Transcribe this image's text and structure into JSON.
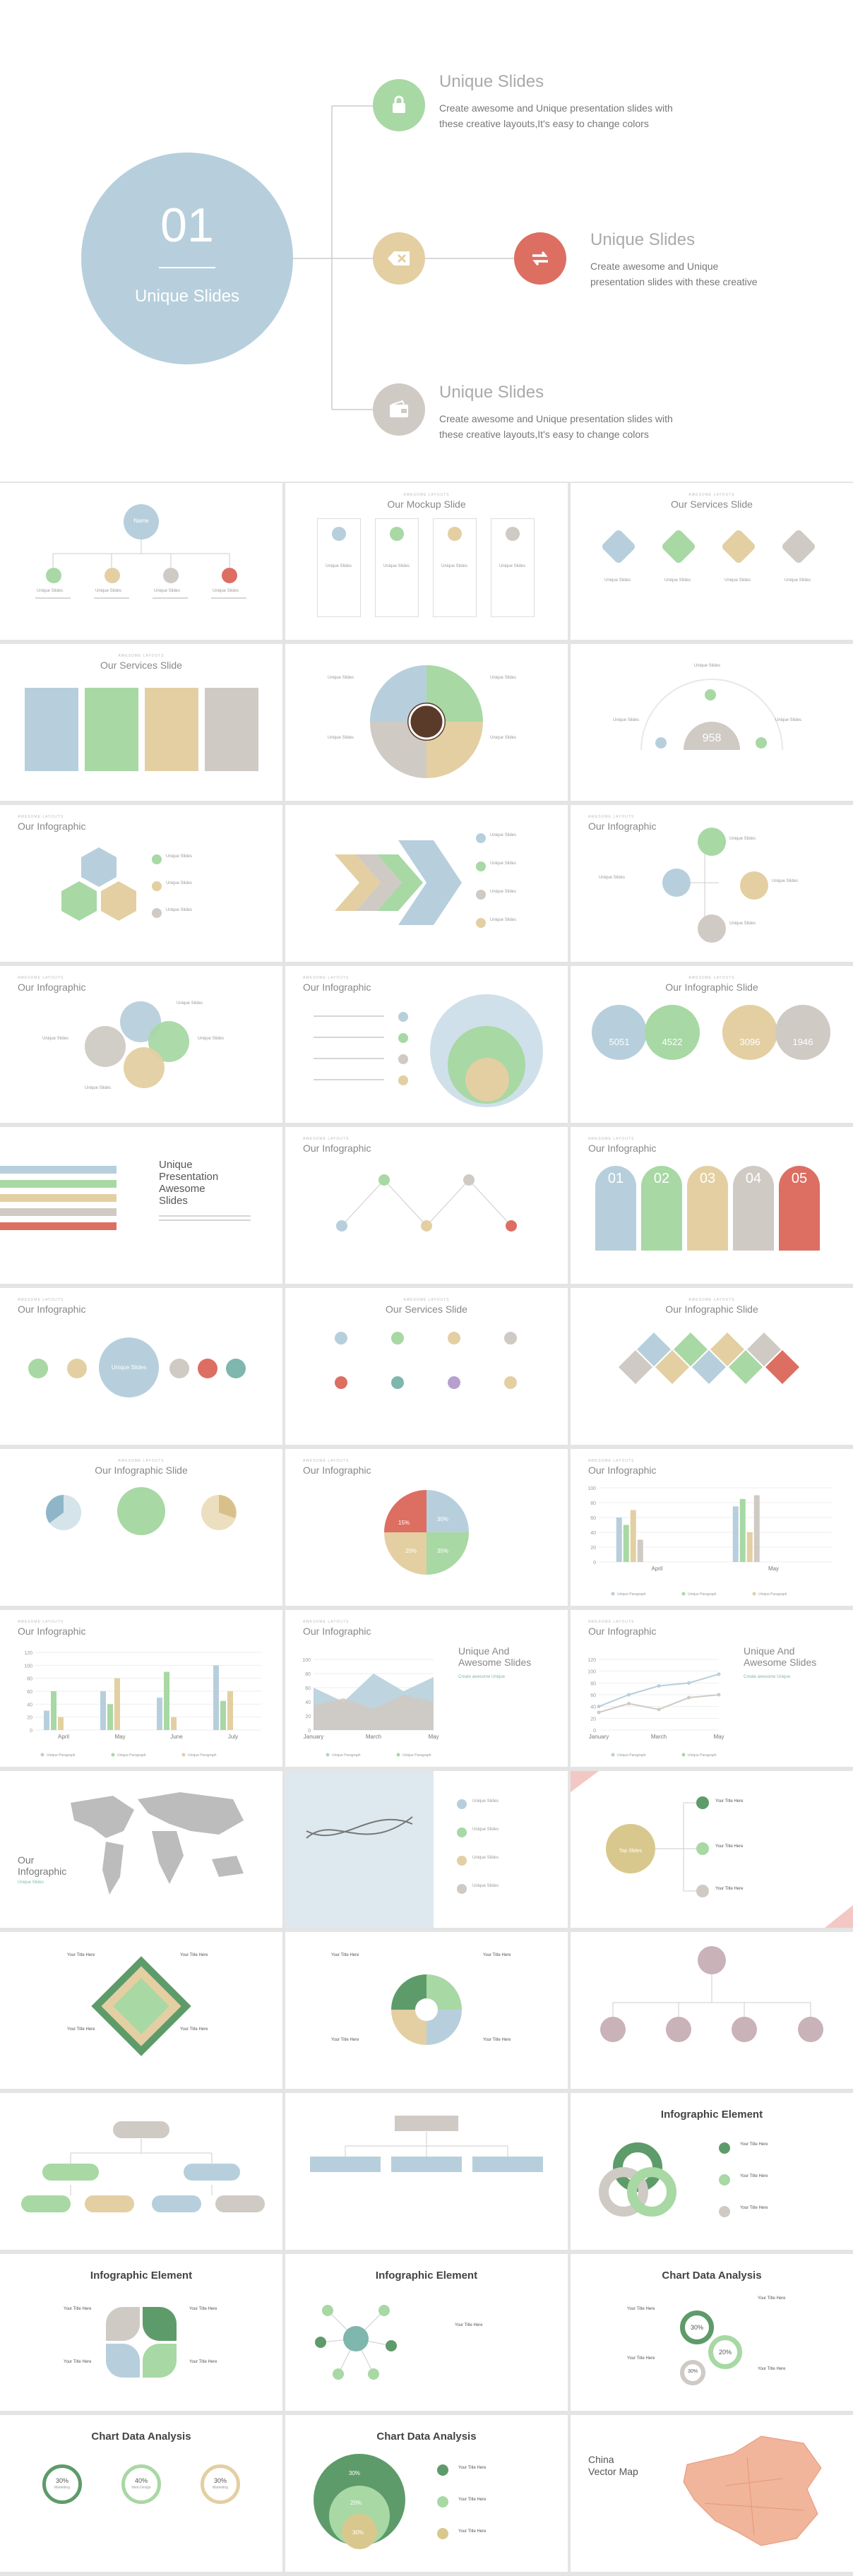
{
  "palette": {
    "blue": "#b7cfdc",
    "green": "#a8d8a4",
    "tan": "#e3cfa2",
    "gray": "#cfcac4",
    "red": "#dd6e62",
    "teal": "#7fb6ad",
    "darkgreen": "#5e9b6a"
  },
  "hero": {
    "number": "01",
    "subtitle": "Unique Slides",
    "items": [
      {
        "title": "Unique Slides",
        "body_line1": "Create awesome and Unique presentation slides with",
        "body_line2": "these creative layouts,It's easy to change colors",
        "icon": "lock-icon"
      },
      {
        "title": "Unique Slides",
        "body_line1": "Create awesome and Unique",
        "body_line2": "presentation slides with these creative",
        "icon": "exchange-icon"
      },
      {
        "title": "Unique Slides",
        "body_line1": "Create awesome and Unique presentation slides with",
        "body_line2": "these creative layouts,It's easy to change colors",
        "icon": "wallet-icon"
      }
    ]
  },
  "common": {
    "kicker": "AWESOME LAYOUTS",
    "unique": "Unique Slides",
    "your_title": "Your Title Here",
    "our_infographic": "Our Infographic",
    "infographic_slide": "Our Infographic Slide",
    "infographic_element": "Infographic Element",
    "chart_data_analysis": "Chart Data Analysis",
    "services": "Our Services Slide",
    "mockup": "Our Mockup Slide"
  },
  "slides": {
    "org_root": "Name",
    "gauge_value": "958",
    "bubbles": [
      "5051",
      "4522",
      "3096",
      "1946"
    ],
    "numbered": [
      "01",
      "02",
      "03",
      "04",
      "05"
    ],
    "awesome": {
      "line1": "Unique",
      "line2": "Presentation",
      "line3": "Awesome",
      "line4": "Slides"
    },
    "unique_awesome": {
      "line1": "Unique And",
      "line2": "Awesome Slides",
      "sub": "Create awesome Unique"
    },
    "map": {
      "title_line1": "Our",
      "title_line2": "Infographic",
      "sub": "Unique Slides"
    },
    "top_slide": "Top Slides",
    "china": {
      "line1": "China",
      "line2": "Vector Map"
    },
    "pie_pcts": [
      "30%",
      "15%",
      "20%",
      "35%"
    ],
    "ring_pcts": [
      "30%",
      "40%",
      "30%"
    ],
    "ring_labels": [
      "Marketing",
      "Web Design",
      "Marketing"
    ],
    "stack_pcts": [
      "30%",
      "20%",
      "30%"
    ],
    "donut3": [
      "30%",
      "20%",
      "30%"
    ]
  },
  "chart_data": [
    {
      "type": "bar",
      "title": "Our Infographic",
      "categories": [
        "April",
        "May"
      ],
      "series": [
        {
          "values": [
            60,
            75
          ]
        },
        {
          "values": [
            50,
            85
          ]
        },
        {
          "values": [
            70,
            40
          ]
        },
        {
          "values": [
            30,
            90
          ]
        }
      ],
      "ylim": [
        0,
        100
      ],
      "yticks": [
        "0",
        "20",
        "40",
        "60",
        "80",
        "100"
      ],
      "legend": [
        "Unique Paragraph",
        "Unique Paragraph",
        "Unique Paragraph"
      ]
    },
    {
      "type": "bar",
      "title": "Our Infographic",
      "categories": [
        "April",
        "May",
        "June",
        "July"
      ],
      "series": [
        {
          "values": [
            30,
            60,
            50,
            100
          ]
        },
        {
          "values": [
            60,
            40,
            90,
            45
          ]
        },
        {
          "values": [
            20,
            80,
            20,
            60
          ]
        }
      ],
      "ylim": [
        0,
        120
      ],
      "yticks": [
        "0",
        "20",
        "40",
        "60",
        "80",
        "100",
        "120"
      ],
      "legend": [
        "Unique Paragraph",
        "Unique Paragraph",
        "Unique Paragraph"
      ]
    },
    {
      "type": "area",
      "title": "Our Infographic",
      "categories": [
        "January",
        "March",
        "May"
      ],
      "series": [
        {
          "values": [
            60,
            40,
            80,
            55,
            75
          ]
        },
        {
          "values": [
            35,
            45,
            30,
            50,
            40
          ]
        }
      ],
      "ylim": [
        0,
        100
      ],
      "yticks": [
        "0",
        "20",
        "40",
        "60",
        "80",
        "100"
      ],
      "legend": [
        "Unique Paragraph",
        "Unique Paragraph"
      ]
    },
    {
      "type": "line",
      "title": "Our Infographic",
      "categories": [
        "January",
        "March",
        "May"
      ],
      "series": [
        {
          "values": [
            40,
            60,
            75,
            80,
            95
          ]
        },
        {
          "values": [
            30,
            45,
            35,
            55,
            60
          ]
        }
      ],
      "ylim": [
        0,
        120
      ],
      "yticks": [
        "0",
        "20",
        "40",
        "60",
        "80",
        "100",
        "120"
      ],
      "legend": [
        "Unique Paragraph",
        "Unique Paragraph"
      ]
    }
  ]
}
